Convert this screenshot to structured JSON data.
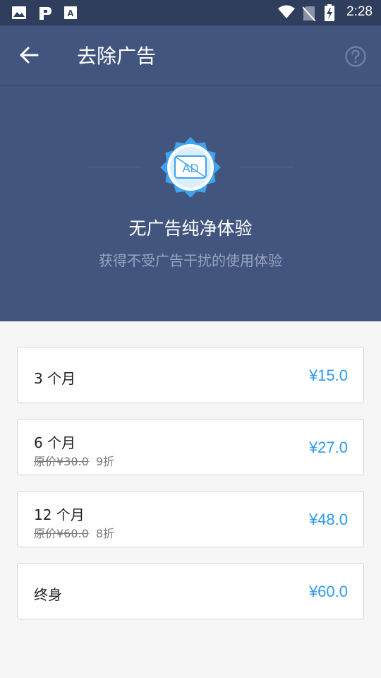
{
  "status_bar": {
    "time": "2:28",
    "icons": [
      "image-icon",
      "parking-app-icon",
      "font-app-icon",
      "wifi-icon",
      "no-sim-icon",
      "battery-charging-icon"
    ]
  },
  "app_bar": {
    "title": "去除广告",
    "back_icon": "arrow-left-icon",
    "help_icon": "help-circle-icon"
  },
  "hero": {
    "badge_text": "AD",
    "title": "无广告纯净体验",
    "subtitle": "获得不受广告干扰的使用体验"
  },
  "plans": [
    {
      "name": "3 个月",
      "price": "¥15.0"
    },
    {
      "name": "6 个月",
      "original": "原价¥30.0",
      "discount": "9折",
      "price": "¥27.0"
    },
    {
      "name": "12 个月",
      "original": "原价¥60.0",
      "discount": "8折",
      "price": "¥48.0"
    },
    {
      "name": "终身",
      "price": "¥60.0"
    }
  ],
  "colors": {
    "status_bar": "#2f3e5c",
    "header": "#42557e",
    "price": "#2f9af0",
    "background": "#f6f6f6"
  }
}
